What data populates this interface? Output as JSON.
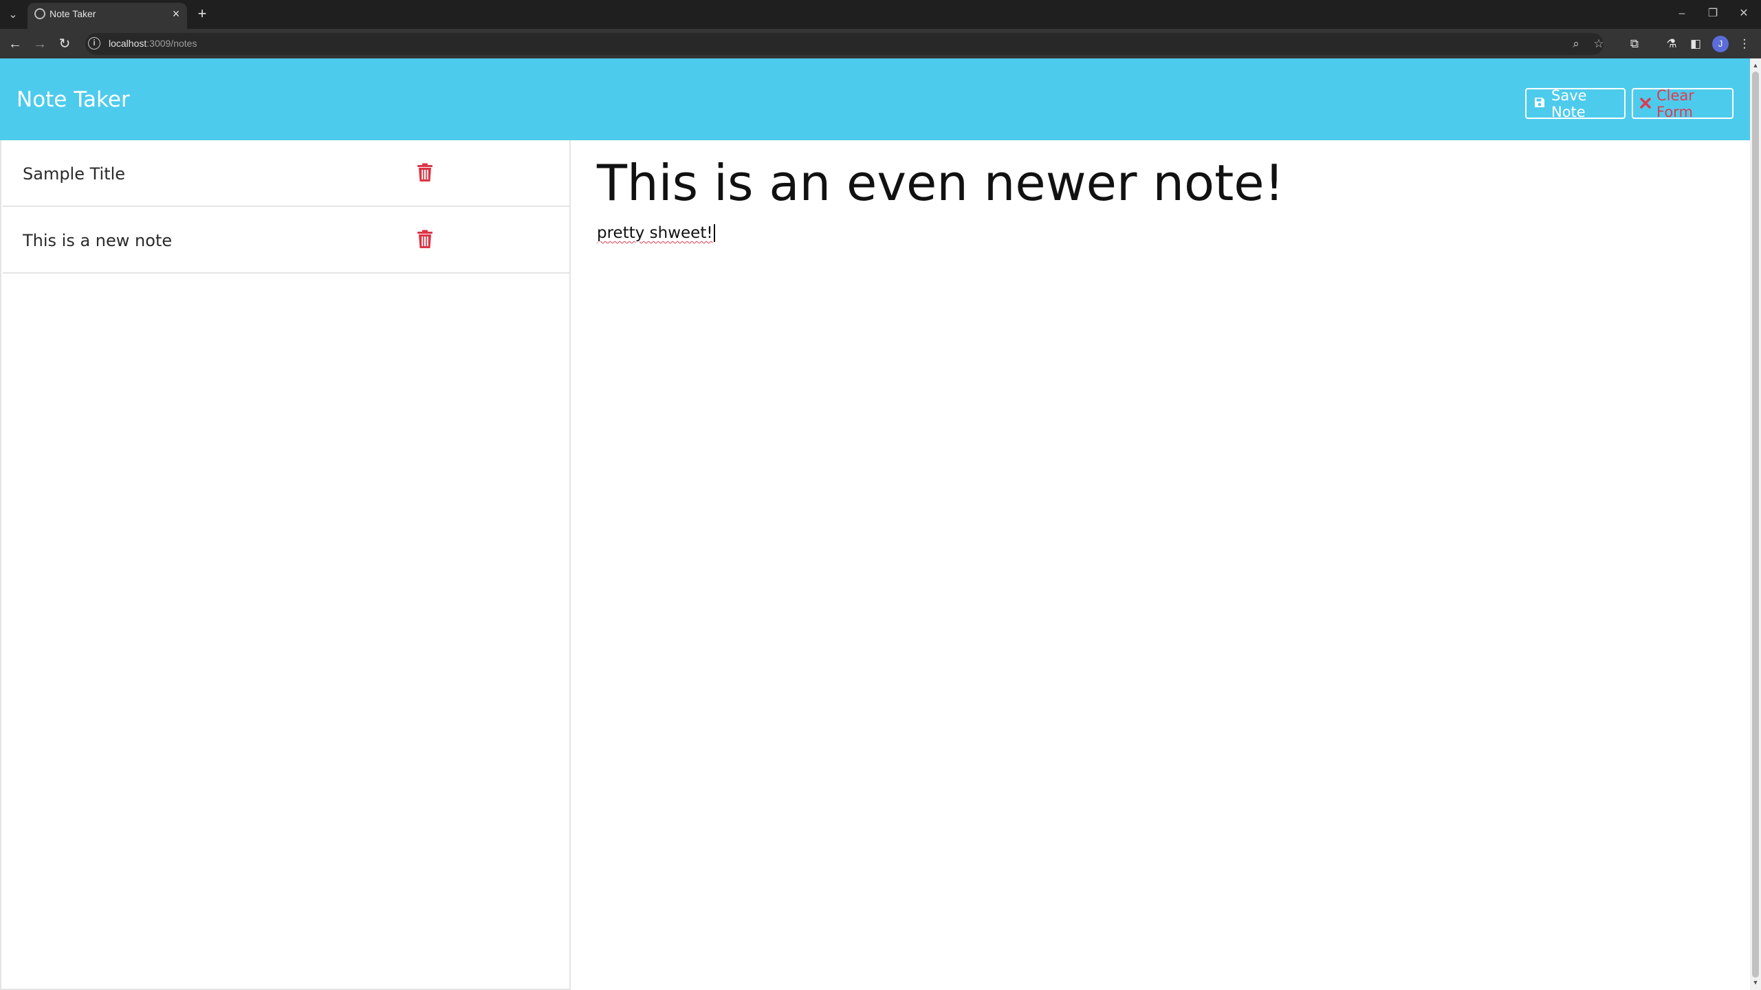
{
  "browser": {
    "tab_title": "Note Taker",
    "url_host": "localhost",
    "url_rest": ":3009/notes",
    "profile_initial": "J"
  },
  "app": {
    "brand": "Note Taker",
    "save_label": "Save Note",
    "clear_label": "Clear Form",
    "clear_color": "#e03a4f",
    "navbar_color": "#4dcbec"
  },
  "notes": [
    {
      "title": "Sample Title"
    },
    {
      "title": "This is a new note"
    }
  ],
  "editor": {
    "title": "This is an even newer note!",
    "text": "pretty shweet!"
  },
  "icons": {
    "save": "save-icon",
    "clear": "close-icon",
    "delete": "trash-icon"
  }
}
